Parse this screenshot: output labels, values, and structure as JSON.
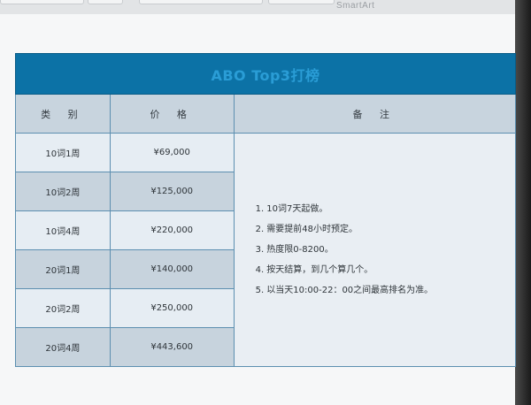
{
  "app": {
    "toolbar_hint": "SmartArt"
  },
  "table": {
    "title": "ABO Top3打榜",
    "headers": {
      "type": "类 别",
      "price": "价 格",
      "notes": "备 注"
    },
    "rows": [
      {
        "type": "10词1周",
        "price": "¥69,000"
      },
      {
        "type": "10词2周",
        "price": "¥125,000"
      },
      {
        "type": "10词4周",
        "price": "¥220,000"
      },
      {
        "type": "20词1周",
        "price": "¥140,000"
      },
      {
        "type": "20词2周",
        "price": "¥250,000"
      },
      {
        "type": "20词4周",
        "price": "¥443,600"
      }
    ],
    "notes": [
      "1. 10词7天起做。",
      "2. 需要提前48小时预定。",
      "3. 热度限0-8200。",
      "4. 按天结算，到几个算几个。",
      "5. 以当天10:00-22：00之间最高排名为准。"
    ]
  },
  "colors": {
    "title_bg": "#0c72a6",
    "title_text": "#2a9dd6",
    "header_bg": "#c8d4de",
    "row_light": "#e6edf3",
    "row_dark": "#c7d3dd",
    "border": "#5c8fb0"
  }
}
